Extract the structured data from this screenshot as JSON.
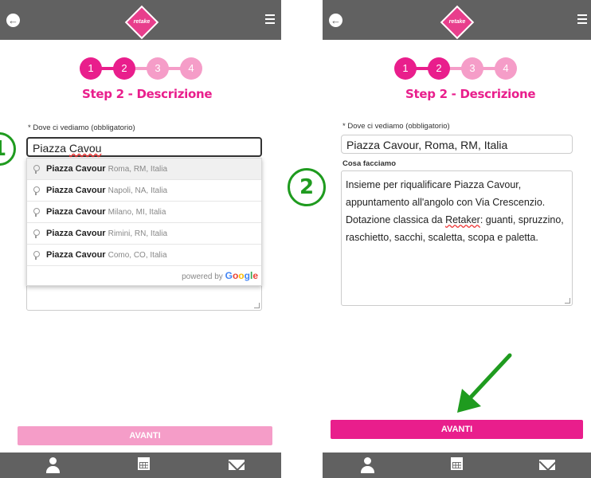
{
  "left": {
    "steps": [
      "1",
      "2",
      "3",
      "4"
    ],
    "step_title": "Step 2 - Descrizione",
    "place_label": "* Dove ci vediamo (obbligatorio)",
    "place_value_a": "Piazza ",
    "place_value_b": "Cavou",
    "suggestions": [
      {
        "main": "Piazza Cavour",
        "secondary": "Roma, RM, Italia"
      },
      {
        "main": "Piazza Cavour",
        "secondary": "Napoli, NA, Italia"
      },
      {
        "main": "Piazza Cavour",
        "secondary": "Milano, MI, Italia"
      },
      {
        "main": "Piazza Cavour",
        "secondary": "Rimini, RN, Italia"
      },
      {
        "main": "Piazza Cavour",
        "secondary": "Como, CO, Italia"
      }
    ],
    "powered_by": "powered by",
    "google": "Google",
    "next_label": "AVANTI",
    "annotation": "1"
  },
  "right": {
    "steps": [
      "1",
      "2",
      "3",
      "4"
    ],
    "step_title": "Step 2 - Descrizione",
    "place_label": "* Dove ci vediamo (obbligatorio)",
    "place_value": "Piazza Cavour, Roma, RM, Italia",
    "desc_label": "Cosa facciamo",
    "desc_a": "Insieme per riqualificare Piazza Cavour, appuntamento all'angolo con Via Crescenzio. Dotazione classica da ",
    "desc_spell": "Retaker",
    "desc_b": ": guanti, spruzzino, raschietto, sacchi, scaletta, scopa e paletta.",
    "next_label": "AVANTI",
    "annotation": "2"
  },
  "logo_text": "retake",
  "colors": {
    "brand": "#e91e8c",
    "brand_light": "#f59dc8",
    "bar": "#616161",
    "annotation": "#1f9b1f"
  },
  "icons": [
    "back-arrow-icon",
    "logo-icon",
    "hamburger-menu-icon",
    "user-icon",
    "calendar-icon",
    "mail-icon"
  ]
}
